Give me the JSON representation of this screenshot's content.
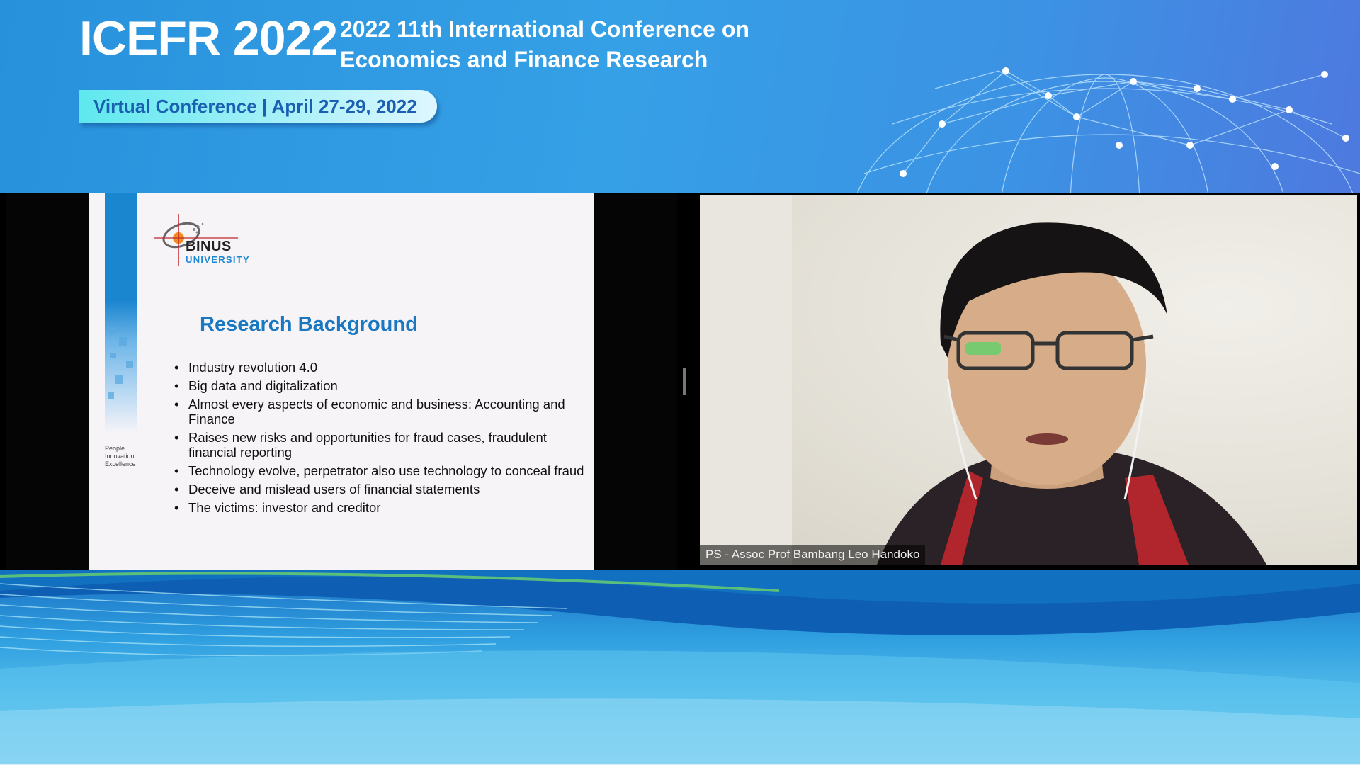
{
  "banner": {
    "short_title": "ICEFR 2022",
    "long_title_line1": "2022 11th International Conference on",
    "long_title_line2": "Economics and Finance Research",
    "virtual_label": "Virtual Conference | April 27-29, 2022"
  },
  "slide": {
    "logo_name": "BINUS",
    "logo_sub": "UNIVERSITY",
    "tagline": [
      "People",
      "Innovation",
      "Excellence"
    ],
    "title": "Research Background",
    "bullets": [
      "Industry revolution 4.0",
      "Big data and digitalization",
      "Almost every aspects of economic and business: Accounting and Finance",
      "Raises new risks and opportunities for fraud cases, fraudulent financial reporting",
      "Technology evolve, perpetrator also use technology to conceal fraud",
      "Deceive and mislead users of financial statements",
      "The victims: investor and creditor"
    ]
  },
  "speaker": {
    "name_label": "PS - Assoc Prof Bambang Leo Handoko"
  },
  "colors": {
    "banner_blue": "#2f9be0",
    "pill_cyan": "#5ee8ee",
    "slide_title_blue": "#1a78c2"
  }
}
